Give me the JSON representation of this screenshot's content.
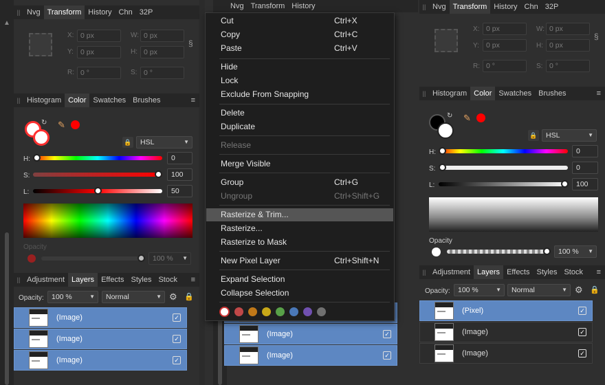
{
  "panel_tabs": {
    "top": [
      "Nvg",
      "Transform",
      "History",
      "Chn",
      "32P"
    ],
    "color": [
      "Histogram",
      "Color",
      "Swatches",
      "Brushes"
    ],
    "layers": [
      "Adjustment",
      "Layers",
      "Effects",
      "Styles",
      "Stock"
    ]
  },
  "transform": {
    "x_label": "X:",
    "y_label": "Y:",
    "w_label": "W:",
    "h_label": "H:",
    "r_label": "R:",
    "s_label": "S:",
    "x": "0 px",
    "y": "0 px",
    "w": "0 px",
    "h": "0 px",
    "r": "0 °",
    "s": "0 °"
  },
  "color_left": {
    "mode": "HSL",
    "h_label": "H:",
    "s_label": "S:",
    "l_label": "L:",
    "h": "0",
    "s": "100",
    "l": "50",
    "opacity_label": "Opacity",
    "opacity": "100 %",
    "h_frac": 0.0,
    "s_frac": 1.0,
    "l_frac": 0.5
  },
  "color_right": {
    "mode": "HSL",
    "h": "0",
    "s": "0",
    "l": "100",
    "opacity_label": "Opacity",
    "opacity": "100 %"
  },
  "layers_left": {
    "opacity_label": "Opacity:",
    "opacity": "100 %",
    "blend": "Normal",
    "rows": [
      "(Image)",
      "(Image)",
      "(Image)"
    ]
  },
  "layers_mid": {
    "rows": [
      "(Image)",
      "(Image)"
    ]
  },
  "layers_right": {
    "opacity_label": "Opacity:",
    "opacity": "100 %",
    "blend": "Normal",
    "rows": [
      "(Pixel)",
      "(Image)",
      "(Image)"
    ]
  },
  "context_menu": {
    "items": [
      {
        "label": "Cut",
        "shortcut": "Ctrl+X"
      },
      {
        "label": "Copy",
        "shortcut": "Ctrl+C"
      },
      {
        "label": "Paste",
        "shortcut": "Ctrl+V"
      },
      {
        "label": "Hide",
        "shortcut": ""
      },
      {
        "label": "Lock",
        "shortcut": ""
      },
      {
        "label": "Exclude From Snapping",
        "shortcut": ""
      },
      {
        "label": "Delete",
        "shortcut": ""
      },
      {
        "label": "Duplicate",
        "shortcut": ""
      },
      {
        "label": "Release",
        "shortcut": ""
      },
      {
        "label": "Merge Visible",
        "shortcut": ""
      },
      {
        "label": "Group",
        "shortcut": "Ctrl+G"
      },
      {
        "label": "Ungroup",
        "shortcut": "Ctrl+Shift+G"
      },
      {
        "label": "Rasterize & Trim...",
        "shortcut": ""
      },
      {
        "label": "Rasterize...",
        "shortcut": ""
      },
      {
        "label": "Rasterize to Mask",
        "shortcut": ""
      },
      {
        "label": "New Pixel Layer",
        "shortcut": "Ctrl+Shift+N"
      },
      {
        "label": "Expand Selection",
        "shortcut": ""
      },
      {
        "label": "Collapse Selection",
        "shortcut": ""
      }
    ],
    "swatch_colors": [
      "#c04848",
      "#c07818",
      "#c8a818",
      "#58a048",
      "#4a78b8",
      "#7050b0",
      "#707070"
    ]
  },
  "colors": {
    "accent_blue": "#5d87c2",
    "menu_bg": "#1e1e1e",
    "primary_red": "#ff0000"
  }
}
